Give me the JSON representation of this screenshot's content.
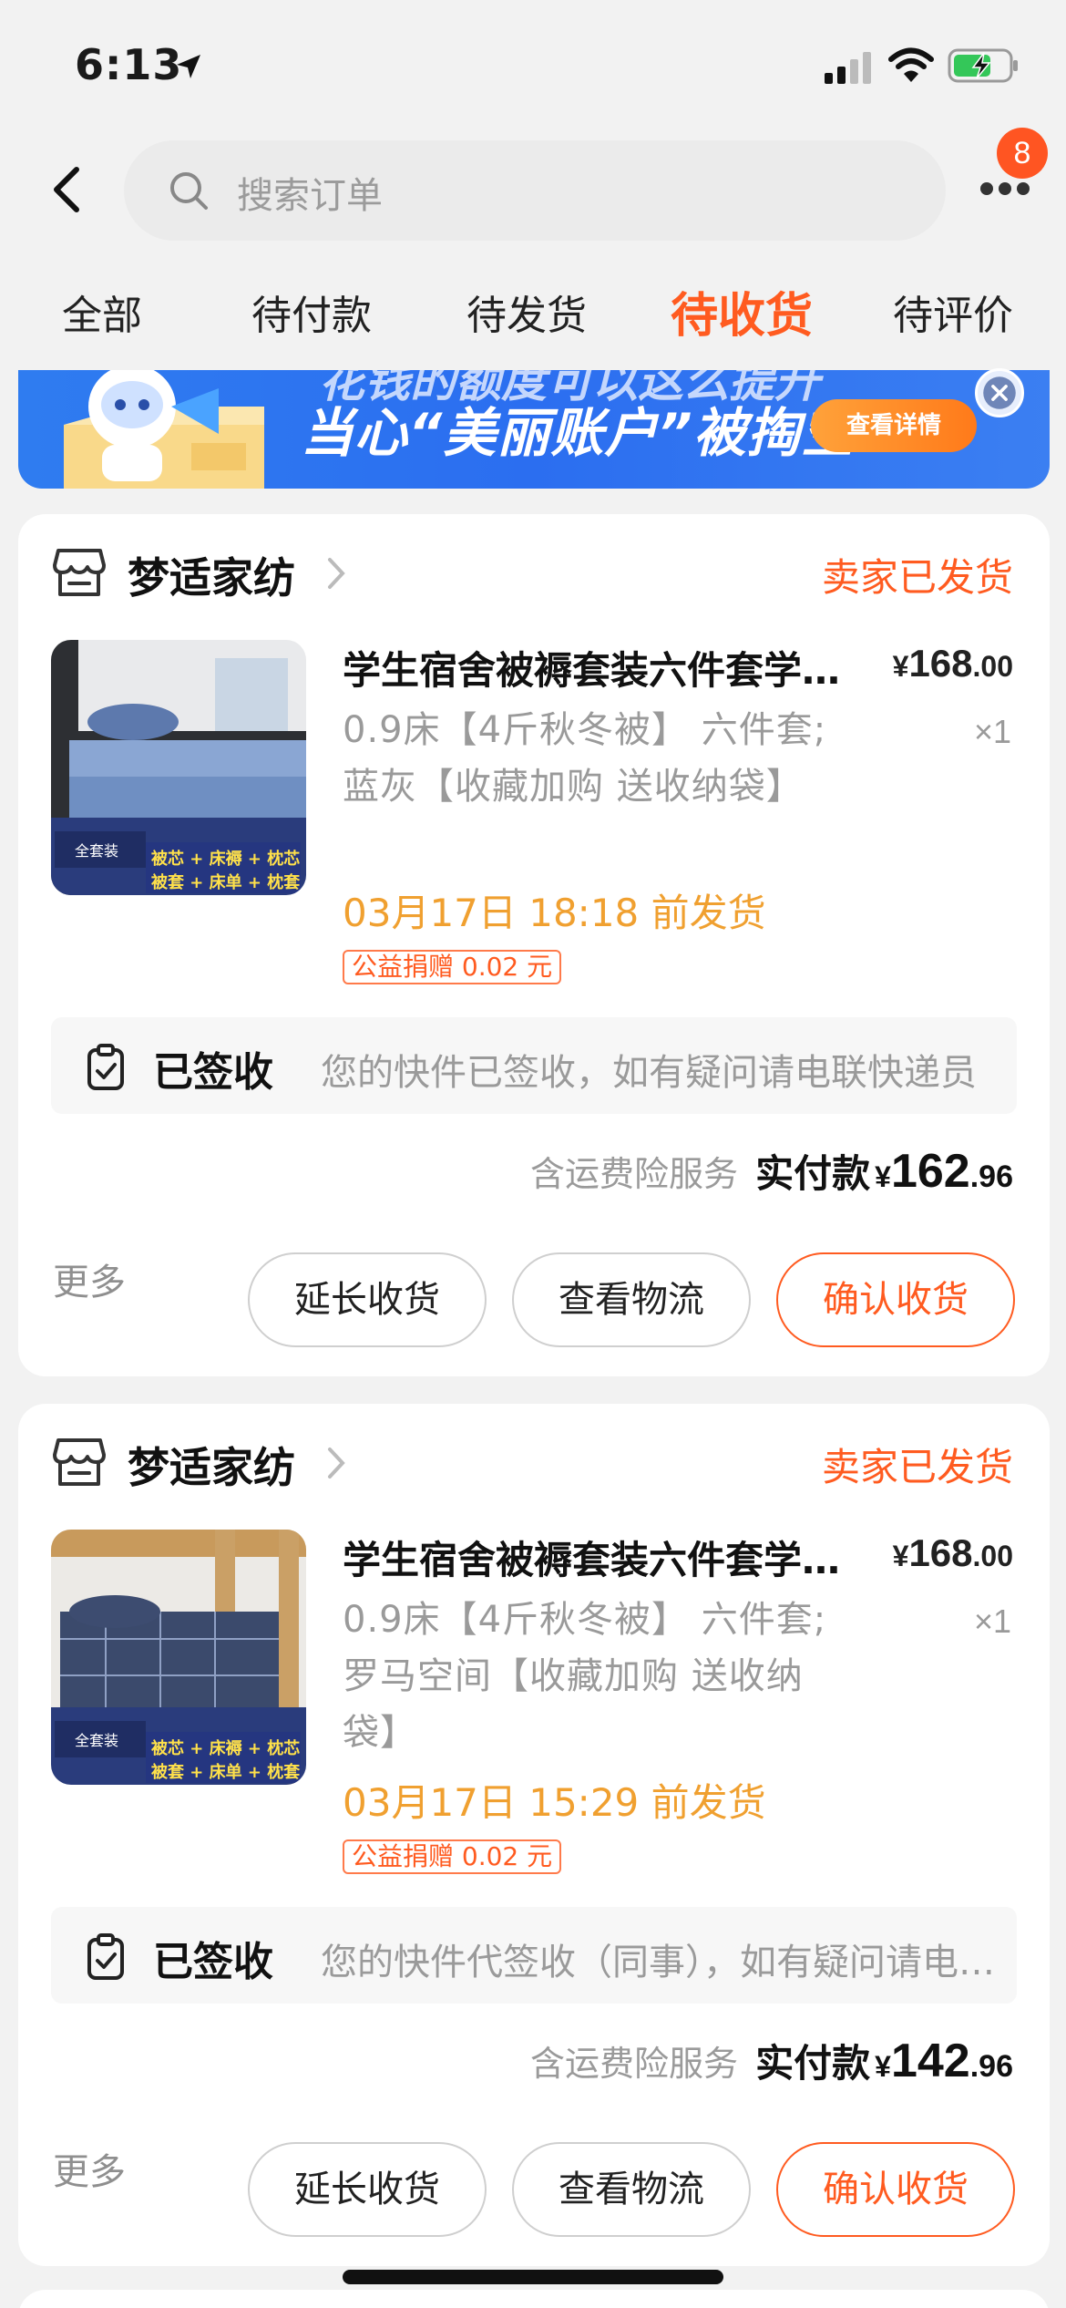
{
  "status_bar": {
    "time": "6:13"
  },
  "header": {
    "search_placeholder": "搜索订单",
    "badge_count": "8"
  },
  "tabs": [
    {
      "label": "全部"
    },
    {
      "label": "待付款"
    },
    {
      "label": "待发货"
    },
    {
      "label": "待收货",
      "active": true
    },
    {
      "label": "待评价"
    }
  ],
  "banner": {
    "top_text": "花钱的额度可以这么提升",
    "text": "当心“美丽账户”被掏空",
    "button_label": "查看详情"
  },
  "orders": [
    {
      "store_name": "梦适家纺",
      "status": "卖家已发货",
      "product_title": "学生宿舍被褥套装六件套学生宿舍被褥套装六件套",
      "sku": "0.9床【4斤秋冬被】 六件套;蓝灰【收藏加购 送收纳袋】",
      "price_yen": "¥",
      "price_int": "168",
      "price_cents": ".00",
      "qty": "×1",
      "ship_deadline": "03月17日 18:18 前发货",
      "charity": "公益捐赠 0.02 元",
      "image_badge": "全套装",
      "image_caption_1": "被芯 + 床褥 + 枕芯",
      "image_caption_2": "被套 + 床单 + 枕套",
      "logistics_status": "已签收",
      "logistics_detail": "您的快件已签收，如有疑问请电联快递员",
      "insurance": "含运费险服务",
      "paid_label": "实付款",
      "paid_yen": "¥",
      "paid_int": "162",
      "paid_cents": ".96",
      "more": "更多",
      "btn_extend": "延长收货",
      "btn_logistics": "查看物流",
      "btn_confirm": "确认收货"
    },
    {
      "store_name": "梦适家纺",
      "status": "卖家已发货",
      "product_title": "学生宿舍被褥套装六件套学生宿舍被褥套装六件套",
      "sku": "0.9床【4斤秋冬被】 六件套;罗马空间【收藏加购 送收纳袋】",
      "price_yen": "¥",
      "price_int": "168",
      "price_cents": ".00",
      "qty": "×1",
      "ship_deadline": "03月17日 15:29 前发货",
      "charity": "公益捐赠 0.02 元",
      "image_badge": "全套装",
      "image_caption_1": "被芯 + 床褥 + 枕芯",
      "image_caption_2": "被套 + 床单 + 枕套",
      "logistics_status": "已签收",
      "logistics_detail": "您的快件代签收（同事），如有疑问请电联快递员",
      "insurance": "含运费险服务",
      "paid_label": "实付款",
      "paid_yen": "¥",
      "paid_int": "142",
      "paid_cents": ".96",
      "more": "更多",
      "btn_extend": "延长收货",
      "btn_logistics": "查看物流",
      "btn_confirm": "确认收货"
    }
  ],
  "colors": {
    "accent": "#ff5b20",
    "deadline": "#f0a030",
    "banner": "#2f7cf0"
  }
}
